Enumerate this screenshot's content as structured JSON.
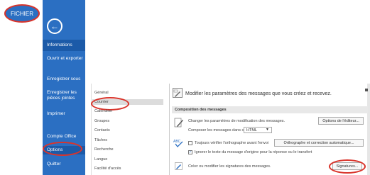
{
  "ribbon": {
    "file_tab": "FICHIER"
  },
  "backstage": {
    "back_icon": "arrow-left-icon",
    "items": [
      {
        "label": "Informations"
      },
      {
        "label": "Ouvrir et exporter"
      },
      {
        "label": "Enregistrer sous"
      },
      {
        "label": "Enregistrer les pièces jointes"
      },
      {
        "label": "Imprimer"
      },
      {
        "label": "Compte Office"
      },
      {
        "label": "Options"
      },
      {
        "label": "Quitter"
      }
    ]
  },
  "options_dialog": {
    "categories": [
      {
        "label": "Général"
      },
      {
        "label": "Courrier"
      },
      {
        "label": "Calendrier"
      },
      {
        "label": "Groupes"
      },
      {
        "label": "Contacts"
      },
      {
        "label": "Tâches"
      },
      {
        "label": "Recherche"
      },
      {
        "label": "Langue"
      },
      {
        "label": "Facilité d'accès"
      }
    ],
    "intro": "Modifier les paramètres des messages que vous créez et recevez.",
    "section_title": "Composition des messages",
    "change_settings_text": "Changer les paramètres de modification des messages.",
    "editor_options_button": "Options de l'éditeur...",
    "compose_format_label": "Composer les messages dans ce format :",
    "compose_format_value": "HTML",
    "spellcheck_label": "Toujours vérifier l'orthographe avant l'envoi",
    "spellcheck_button": "Orthographe et correction automatique...",
    "ignore_original_label": "Ignorer le texte du message d'origine pour la réponse ou le transfert",
    "signatures_text": "Créer ou modifier les signatures des messages.",
    "signatures_button": "Signatures..."
  },
  "colors": {
    "accent": "#2b6fc2",
    "highlight_ring": "#d9342b"
  }
}
